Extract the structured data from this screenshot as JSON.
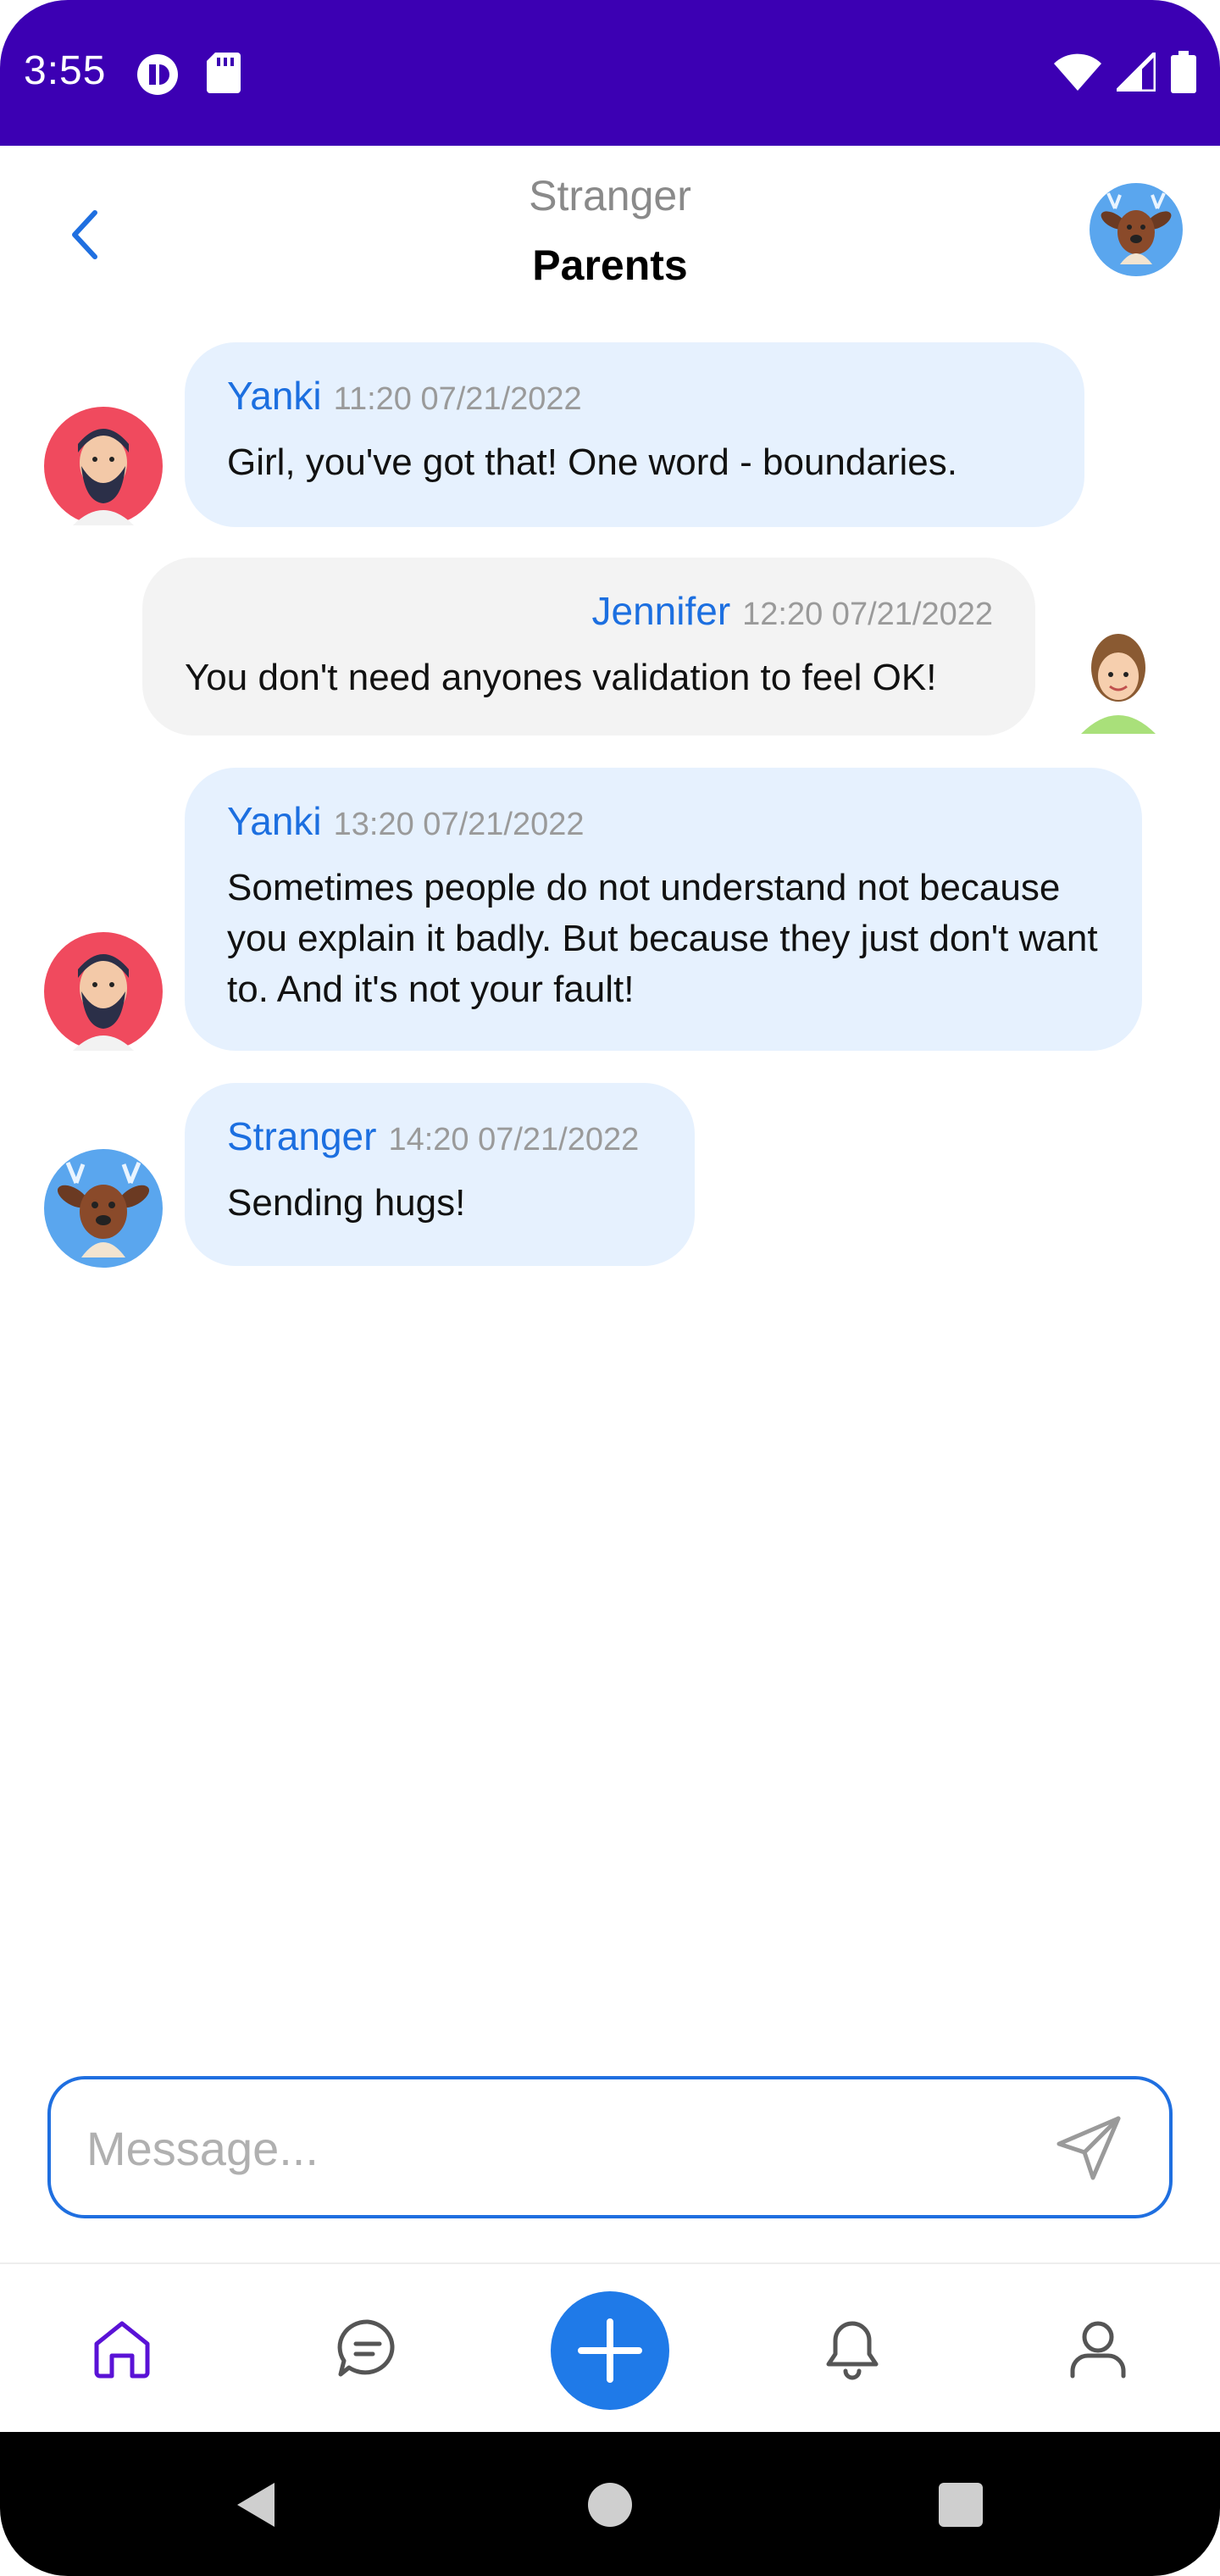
{
  "status_bar": {
    "time": "3:55"
  },
  "header": {
    "subtitle": "Stranger",
    "title": "Parents"
  },
  "messages": [
    {
      "author": "Yanki",
      "time": "11:20 07/21/2022",
      "text": "Girl, you've got that! One word - boundaries."
    },
    {
      "author": "Jennifer",
      "time": "12:20 07/21/2022",
      "text": "You don't need anyones validation to feel OK!"
    },
    {
      "author": "Yanki",
      "time": "13:20 07/21/2022",
      "text": "Sometimes people do not understand not because you explain it badly. But because they just don't want to. And it's not your fault!"
    },
    {
      "author": "Stranger",
      "time": "14:20 07/21/2022",
      "text": "Sending hugs!"
    }
  ],
  "composer": {
    "placeholder": "Message..."
  },
  "colors": {
    "accent": "#1f7ae8",
    "status_bar": "#3c00b3",
    "bubble_in": "#e6f1fe",
    "bubble_out": "#f3f3f3",
    "name": "#1c6fe0",
    "home_active": "#5a12d6"
  },
  "icons": {
    "back": "chevron-left-icon",
    "send": "send-icon",
    "nav": [
      "home-icon",
      "chat-icon",
      "plus-icon",
      "bell-icon",
      "user-icon"
    ]
  }
}
